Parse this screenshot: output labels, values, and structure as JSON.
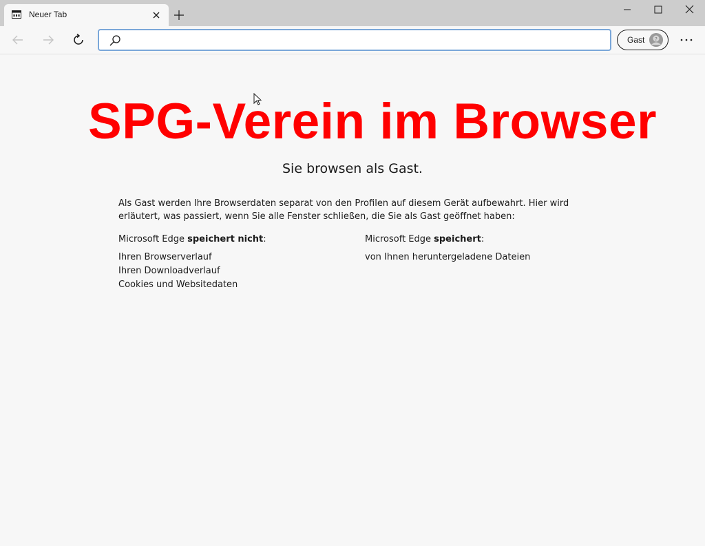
{
  "tab": {
    "title": "Neuer Tab"
  },
  "address_bar": {
    "value": "",
    "placeholder": ""
  },
  "profile": {
    "label": "Gast"
  },
  "page": {
    "banner": "SPG-Verein im Browser",
    "subtitle": "Sie browsen als Gast.",
    "description": "Als Gast werden Ihre Browserdaten separat von den Profilen auf diesem Gerät aufbewahrt. Hier wird erläutert, was passiert, wenn Sie alle Fenster schließen, die Sie als Gast geöffnet haben:",
    "not_saved": {
      "prefix": "Microsoft Edge ",
      "emphasis": "speichert nicht",
      "suffix": ":",
      "items": [
        "Ihren Browserverlauf",
        "Ihren Downloadverlauf",
        "Cookies und Websitedaten"
      ]
    },
    "saved": {
      "prefix": "Microsoft Edge ",
      "emphasis": "speichert",
      "suffix": ":",
      "items": [
        "von Ihnen heruntergeladene Dateien"
      ]
    }
  },
  "colors": {
    "banner": "#ff0000",
    "address_border": "#7aa7d9"
  }
}
